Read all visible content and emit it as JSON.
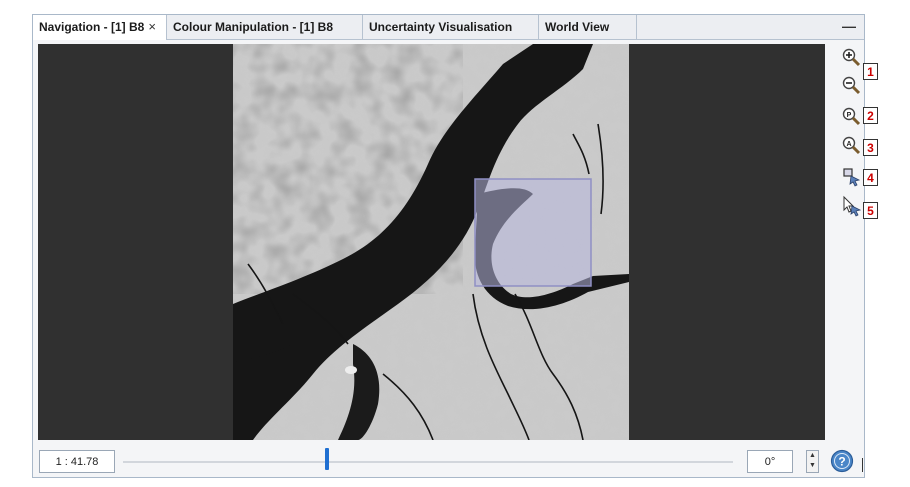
{
  "tabs": [
    {
      "label": "Navigation - [1] B8",
      "close": "×",
      "active": true
    },
    {
      "label": "Colour Manipulation - [1] B8",
      "active": false
    },
    {
      "label": "Uncertainty Visualisation",
      "active": false
    },
    {
      "label": "World View",
      "active": false
    }
  ],
  "minimize_label": "—",
  "tools": [
    {
      "icon": "zoom-in-icon",
      "callout": "1"
    },
    {
      "icon": "zoom-out-icon",
      "callout": ""
    },
    {
      "icon": "zoom-pixel-icon",
      "callout": "2"
    },
    {
      "icon": "zoom-all-icon",
      "callout": "3"
    },
    {
      "icon": "sync-views-icon",
      "callout": "4"
    },
    {
      "icon": "sync-cursor-icon",
      "callout": "5"
    }
  ],
  "bottom": {
    "scale": "1 : 41.78",
    "zoom_slider_fraction": 0.34,
    "angle": "0°"
  },
  "colors": {
    "viewport_bg": "#303030",
    "overlay_fill": "#b6b6dc",
    "slider_thumb": "#1f6fd1",
    "callout_text": "#cc0000"
  }
}
